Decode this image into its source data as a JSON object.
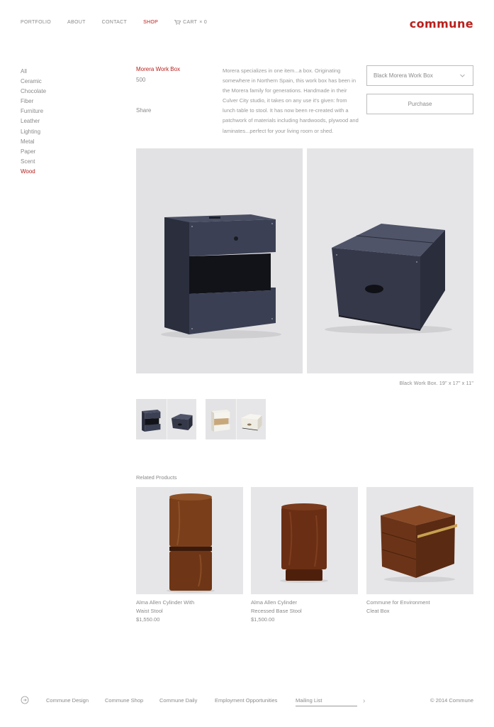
{
  "header": {
    "nav": [
      "PORTFOLIO",
      "ABOUT",
      "CONTACT",
      "SHOP"
    ],
    "active_nav": "SHOP",
    "cart_label": "CART",
    "cart_count": "× 0",
    "logo": "commune"
  },
  "sidebar": {
    "categories": [
      "All",
      "Ceramic",
      "Chocolate",
      "Fiber",
      "Furniture",
      "Leather",
      "Lighting",
      "Metal",
      "Paper",
      "Scent",
      "Wood"
    ],
    "active": "Wood"
  },
  "product": {
    "title": "Morera Work Box",
    "price": "500",
    "share_label": "Share",
    "description": "Morera specializes in one item...a box. Originating somewhere in Northern Spain, this work box has been in the Morera family for generations. Handmade in their Culver City studio, it takes on any use it's given: from lunch table to stool. It has now been re-created with a patchwork of materials including hardwoods, plywood and laminates...perfect for your living room or shed.",
    "variant_selected": "Black Morera Work Box",
    "purchase_label": "Purchase",
    "image_caption": "Black Work Box. 19\" x 17\" x 11\""
  },
  "related": {
    "label": "Related Products",
    "items": [
      {
        "name_line1": "Alma Allen Cylinder With",
        "name_line2": "Waist Stool",
        "price": "$1,550.00"
      },
      {
        "name_line1": "Alma Allen Cylinder",
        "name_line2": "Recessed Base Stool",
        "price": "$1,500.00"
      },
      {
        "name_line1": "Commune for Environment",
        "name_line2": "Cleat Box",
        "price": ""
      }
    ]
  },
  "footer": {
    "links": [
      "Commune Design",
      "Commune Shop",
      "Commune Daily",
      "Employment Opportunities"
    ],
    "mailing_placeholder": "Mailing List",
    "copyright": "© 2014 Commune"
  },
  "colors": {
    "accent": "#b8201c",
    "text": "#8a8a8a",
    "box_dark": "#3a3f52",
    "wood": "#6a3a1c"
  }
}
